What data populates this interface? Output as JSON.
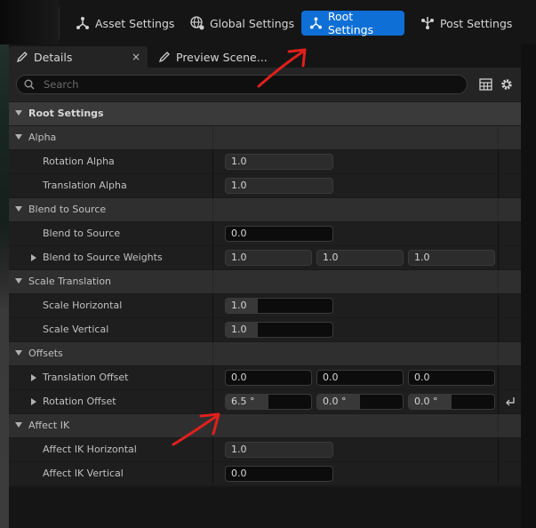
{
  "toolbar": {
    "buttons": [
      {
        "label": "Asset Settings",
        "icon": "asset-settings-icon"
      },
      {
        "label": "Global Settings",
        "icon": "globe-icon"
      },
      {
        "label": "Root Settings",
        "icon": "root-settings-icon",
        "active": true
      },
      {
        "label": "Post Settings",
        "icon": "post-settings-icon"
      }
    ]
  },
  "tabs": [
    {
      "label": "Details",
      "icon": "pencil-icon",
      "close": "×"
    },
    {
      "label": "Preview Scene...",
      "icon": "pencil-icon"
    }
  ],
  "search": {
    "placeholder": "Search"
  },
  "sections": {
    "root": "Root Settings",
    "alpha": {
      "title": "Alpha",
      "rotation_alpha": {
        "label": "Rotation Alpha",
        "value": "1.0"
      },
      "translation_alpha": {
        "label": "Translation Alpha",
        "value": "1.0"
      }
    },
    "blend": {
      "title": "Blend to Source",
      "blend_to_source": {
        "label": "Blend to Source",
        "value": "0.0"
      },
      "weights": {
        "label": "Blend to Source Weights",
        "values": [
          "1.0",
          "1.0",
          "1.0"
        ]
      }
    },
    "scale": {
      "title": "Scale Translation",
      "horizontal": {
        "label": "Scale Horizontal",
        "value": "1.0",
        "fill": 0.2
      },
      "vertical": {
        "label": "Scale Vertical",
        "value": "1.0",
        "fill": 0.2
      }
    },
    "offsets": {
      "title": "Offsets",
      "translation": {
        "label": "Translation Offset",
        "values": [
          "0.0",
          "0.0",
          "0.0"
        ]
      },
      "rotation": {
        "label": "Rotation Offset",
        "values": [
          "6.5 °",
          "0.0 °",
          "0.0 °"
        ],
        "fills": [
          0.5,
          0.5,
          0.5
        ]
      }
    },
    "ik": {
      "title": "Affect IK",
      "horizontal": {
        "label": "Affect IK Horizontal",
        "value": "1.0"
      },
      "vertical": {
        "label": "Affect IK Vertical",
        "value": "0.0"
      }
    }
  },
  "colors": {
    "accent": "#0e6fd6",
    "annotation": "#e0201c"
  }
}
